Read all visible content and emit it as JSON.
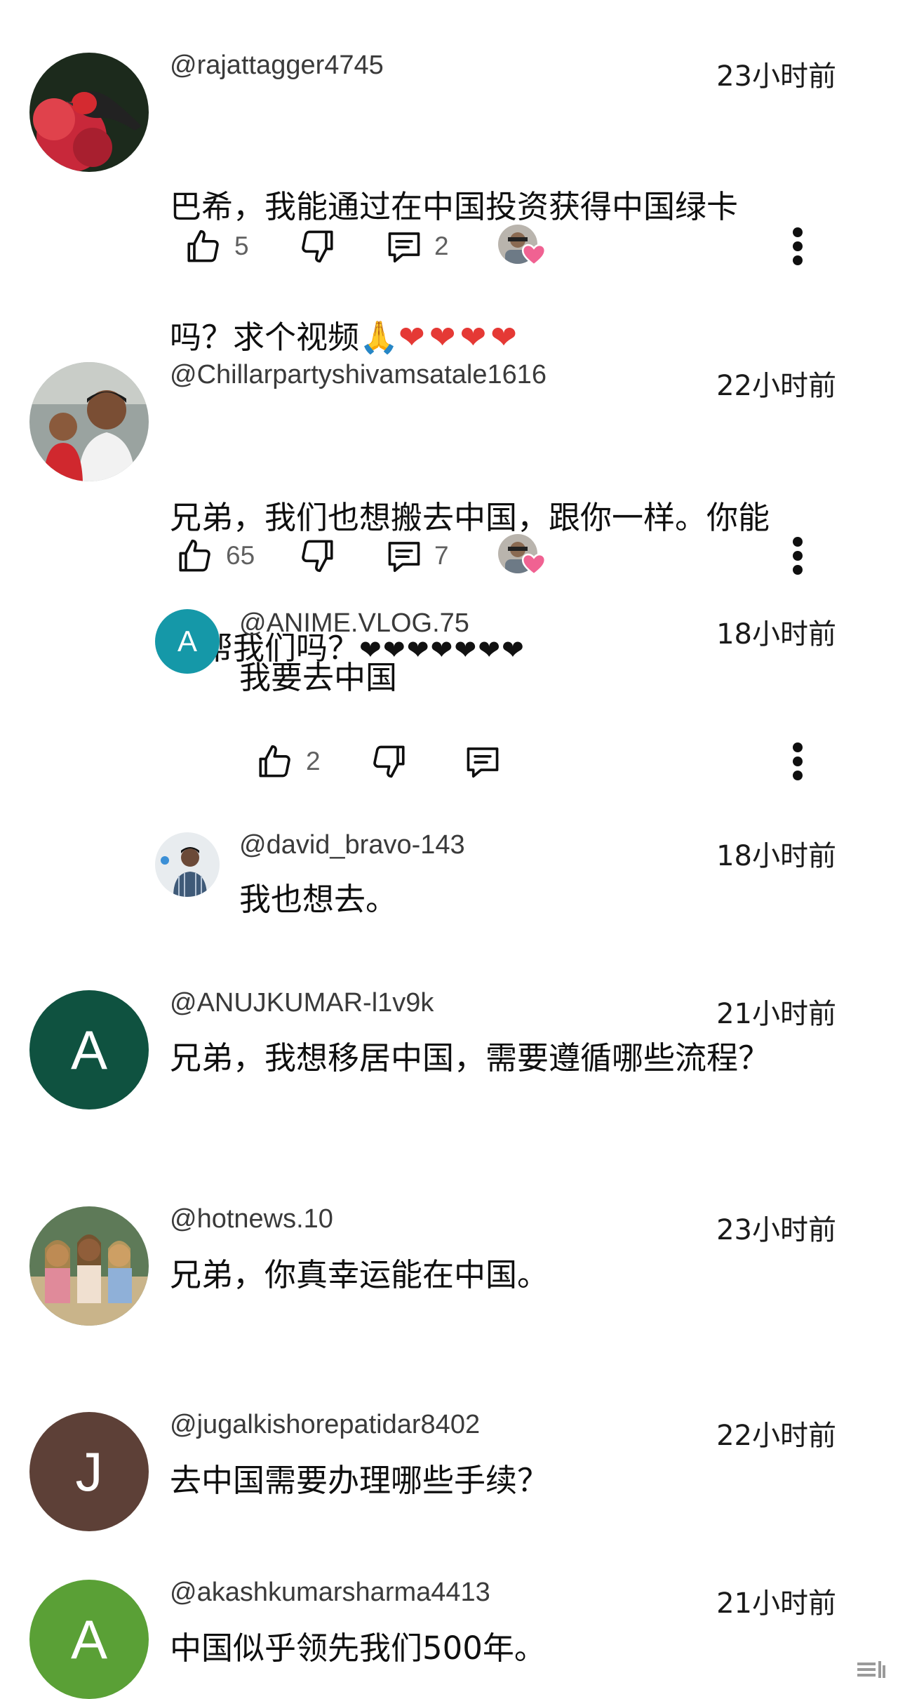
{
  "comments": [
    {
      "handle": "@rajattagger4745",
      "time": "23小时前",
      "line1": "巴希，我能通过在中国投资获得中国绿卡",
      "line2_text": "吗？求个视频",
      "emoji_pray": "🙏",
      "hearts": "❤❤❤❤",
      "likes": "5",
      "replies": "2"
    },
    {
      "handle": "@Chillarpartyshivamsatale1616",
      "time": "22小时前",
      "line1": "兄弟，我们也想搬去中国，跟你一样。你能",
      "line2_text": "帮帮我们吗？",
      "hearts": "❤❤❤❤❤❤❤",
      "likes": "65",
      "replies": "7",
      "reply_list": [
        {
          "initial": "A",
          "handle": "@ANIME.VLOG.75",
          "time": "18小时前",
          "text": "我要去中国",
          "likes": "2"
        },
        {
          "handle": "@david_bravo-143",
          "time": "18小时前",
          "text": "我也想去。"
        }
      ]
    },
    {
      "initial": "A",
      "handle": "@ANUJKUMAR-l1v9k",
      "time": "21小时前",
      "text": "兄弟，我想移居中国，需要遵循哪些流程？"
    },
    {
      "handle": "@hotnews.10",
      "time": "23小时前",
      "text": "兄弟，你真幸运能在中国。"
    },
    {
      "initial": "J",
      "handle": "@jugalkishorepatidar8402",
      "time": "22小时前",
      "text": "去中国需要办理哪些手续？"
    },
    {
      "initial": "A",
      "handle": "@akashkumarsharma4413",
      "time": "21小时前",
      "text": "中国似乎领先我们500年。"
    }
  ],
  "colors": {
    "anime_avatar": "#1598a8",
    "anuj_avatar": "#0f5240",
    "jugal_avatar": "#5d4037",
    "akash_avatar": "#5aa036",
    "heart_red": "#e53935"
  },
  "icons": [
    "thumbs-up-icon",
    "thumbs-down-icon",
    "reply-icon",
    "more-vert-icon",
    "creator-heart-icon"
  ]
}
